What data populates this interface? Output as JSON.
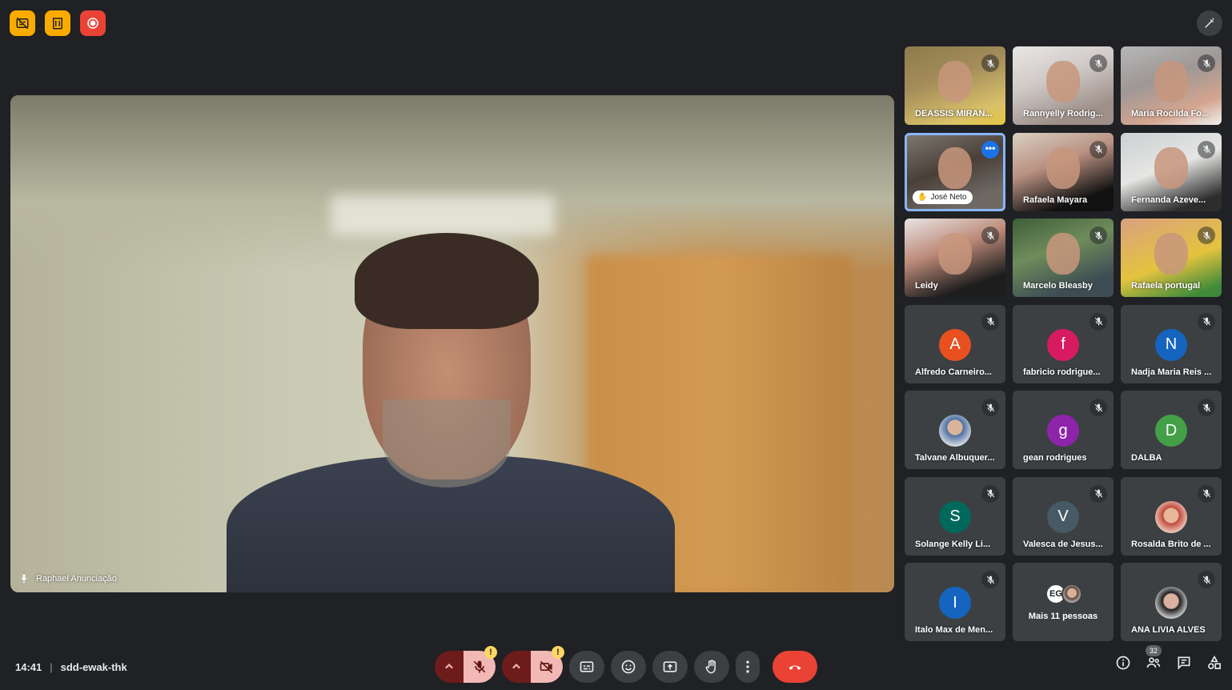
{
  "meeting": {
    "time": "14:41",
    "separator": "|",
    "code": "sdd-ewak-thk"
  },
  "spotlight": {
    "name": "Raphael Anunciação",
    "pin_icon": "pin-icon"
  },
  "top_badges": [
    {
      "icon": "captions-off-icon",
      "color": "#f9ab00"
    },
    {
      "icon": "host-controls-icon",
      "color": "#f9ab00"
    },
    {
      "icon": "recording-icon",
      "color": "#ea4335"
    }
  ],
  "participants": [
    {
      "name": "DEASSIS MIRAN...",
      "type": "video",
      "muted": true
    },
    {
      "name": "Rannyelly Rodrig...",
      "type": "video",
      "muted": true
    },
    {
      "name": "Maria Rocilda Fo...",
      "type": "video",
      "muted": true
    },
    {
      "name": "José Neto",
      "type": "video",
      "muted": false,
      "speaking": true
    },
    {
      "name": "Rafaela Mayara",
      "type": "video",
      "muted": true
    },
    {
      "name": "Fernanda Azeve...",
      "type": "video",
      "muted": true
    },
    {
      "name": "Leidy",
      "type": "video",
      "muted": true
    },
    {
      "name": "Marcelo Bleasby",
      "type": "video",
      "muted": true
    },
    {
      "name": "Rafaela portugal",
      "type": "video",
      "muted": true
    },
    {
      "name": "Alfredo Carneiro...",
      "initial": "A",
      "color": "#e8501f",
      "muted": true
    },
    {
      "name": "fabricio rodrigue...",
      "initial": "f",
      "color": "#d81b60",
      "muted": true
    },
    {
      "name": "Nadja Maria Reis ...",
      "initial": "N",
      "color": "#1565c0",
      "muted": true
    },
    {
      "name": "Talvane Albuquer...",
      "initial": "",
      "color": "photo",
      "muted": true
    },
    {
      "name": "gean rodrigues",
      "initial": "g",
      "color": "#8e24aa",
      "muted": true
    },
    {
      "name": "DALBA",
      "initial": "D",
      "color": "#43a047",
      "muted": true
    },
    {
      "name": "Solange Kelly Li...",
      "initial": "S",
      "color": "#00695c",
      "muted": true
    },
    {
      "name": "Valesca de Jesus...",
      "initial": "V",
      "color": "#455a64",
      "muted": true
    },
    {
      "name": "Rosalda Brito de ...",
      "initial": "",
      "color": "photo2",
      "muted": true
    },
    {
      "name": "Italo Max de Men...",
      "initial": "I",
      "color": "#1565c0",
      "muted": true
    },
    {
      "name": "Mais 11 pessoas",
      "initial": "EG",
      "color": "more",
      "muted": false
    },
    {
      "name": "ANA LIVIA ALVES",
      "initial": "",
      "color": "photo3",
      "muted": true
    }
  ],
  "controls": {
    "mic_warning": "!",
    "cam_warning": "!",
    "people_count": "32"
  }
}
